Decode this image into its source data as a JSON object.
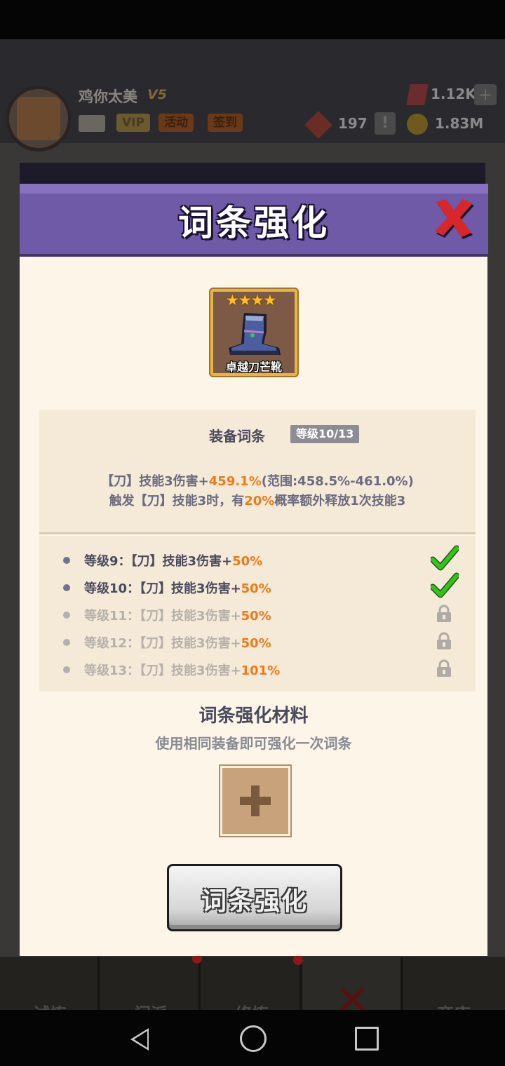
{
  "background_game": {
    "player_name": "鸡你太美",
    "vip_tag": "V5",
    "chips": {
      "vip": "VIP",
      "activity": "活动",
      "signin": "签到"
    },
    "resources": {
      "gems": "1.12K",
      "tokens": "197",
      "coins": "1.83M"
    },
    "bottom_nav": [
      "试炼",
      "门派",
      "修炼",
      "",
      "商店"
    ]
  },
  "modal": {
    "title": "词条强化",
    "item": {
      "name": "卓越刀芒靴",
      "stars": "★★★★"
    },
    "affix": {
      "title": "装备词条",
      "level_badge": "等级10/13",
      "line1": {
        "prefix": "【刀】技能3伤害+",
        "value": "459.1%",
        "suffix": "(范围:458.5%-461.0%)"
      },
      "line2": {
        "prefix": "触发【刀】技能3时，有",
        "value": "20%",
        "suffix": "概率额外释放1次技能3"
      }
    },
    "levels": [
      {
        "label": "等级9：【刀】技能3伤害+",
        "value": "50%",
        "status": "unlocked"
      },
      {
        "label": "等级10：【刀】技能3伤害+",
        "value": "50%",
        "status": "unlocked"
      },
      {
        "label": "等级11：【刀】技能3伤害+",
        "value": "50%",
        "status": "locked"
      },
      {
        "label": "等级12：【刀】技能3伤害+",
        "value": "50%",
        "status": "locked"
      },
      {
        "label": "等级13：【刀】技能3伤害+",
        "value": "101%",
        "status": "locked"
      }
    ],
    "material": {
      "title": "词条强化材料",
      "subtitle": "使用相同装备即可强化一次词条"
    },
    "button_label": "词条强化"
  },
  "colors": {
    "header": "#6e5aa6",
    "body": "#fdf6e8",
    "highlight": "#f07a1a",
    "check": "#35c21a"
  }
}
